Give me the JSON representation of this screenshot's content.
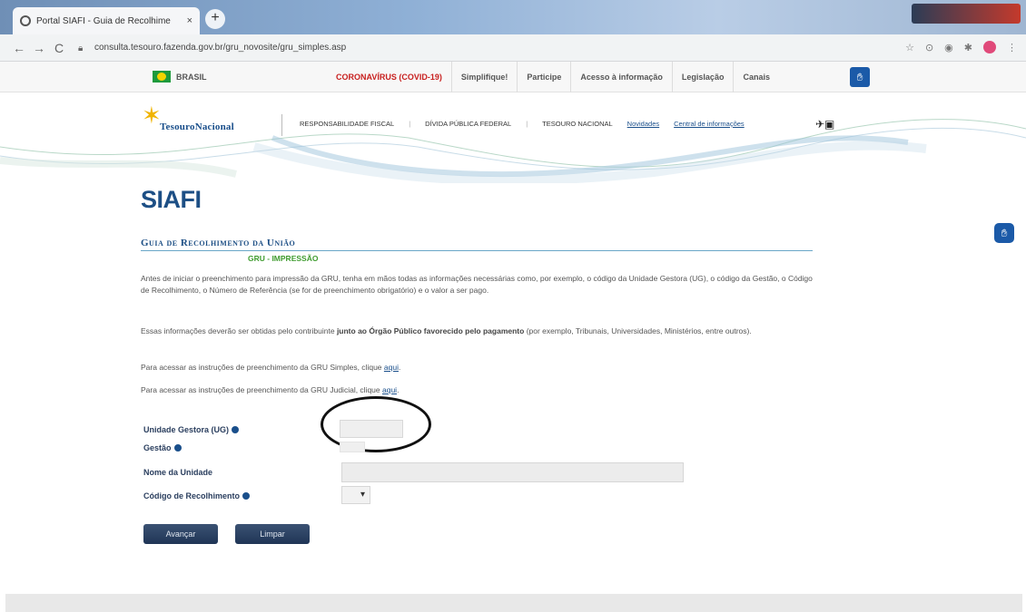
{
  "browser": {
    "tab_title": "Portal SIAFI - Guia de Recolhime",
    "tab_close": "×",
    "new_tab": "+",
    "back": "←",
    "forward": "→",
    "reload": "C",
    "url": "consulta.tesouro.fazenda.gov.br/gru_novosite/gru_simples.asp",
    "ext_icons": [
      "☆",
      "⊙",
      "◉",
      "✱"
    ],
    "menu": "⋮"
  },
  "govbar": {
    "brasil": "BRASIL",
    "items": [
      "CORONAVÍRUS (COVID-19)",
      "Simplifique!",
      "Participe",
      "Acesso à informação",
      "Legislação",
      "Canais"
    ],
    "covid_color": "#c8201f"
  },
  "header": {
    "logo_text": "TesouroNacional",
    "nav": [
      "RESPONSABILIDADE FISCAL",
      "DÍVIDA PÚBLICA FEDERAL",
      "TESOURO NACIONAL"
    ],
    "links": [
      "Novidades",
      "Central de informações"
    ],
    "sep": "|"
  },
  "main": {
    "title": "SIAFI",
    "section_title": "Guia de Recolhimento da União",
    "section_sub": "GRU - IMPRESSÃO",
    "p1": "Antes de iniciar o preenchimento para impressão da GRU, tenha em mãos todas as informações necessárias como, por exemplo, o código da Unidade Gestora (UG), o código da Gestão, o Código de Recolhimento, o Número de Referência (se for de preenchimento obrigatório) e o valor a ser pago.",
    "p2_start": "Essas informações deverão ser obtidas pelo contribuinte ",
    "p2_bold": "junto ao Órgão Público favorecido pelo pagamento",
    "p2_end": " (por exemplo, Tribunais, Universidades, Ministérios, entre outros).",
    "p3_text": "Para acessar as instruções de preenchimento da GRU Simples, clique ",
    "p3_link": "aqui",
    "p4_text": "Para acessar as instruções de preenchimento da GRU Judicial, clique ",
    "p4_link": "aqui",
    "period": "."
  },
  "form": {
    "ug_label": "Unidade Gestora (UG)",
    "gestao_label": "Gestão",
    "nome_label": "Nome da Unidade",
    "codigo_label": "Código de Recolhimento",
    "select_arrow": "▾",
    "avancar": "Avançar",
    "limpar": "Limpar"
  }
}
